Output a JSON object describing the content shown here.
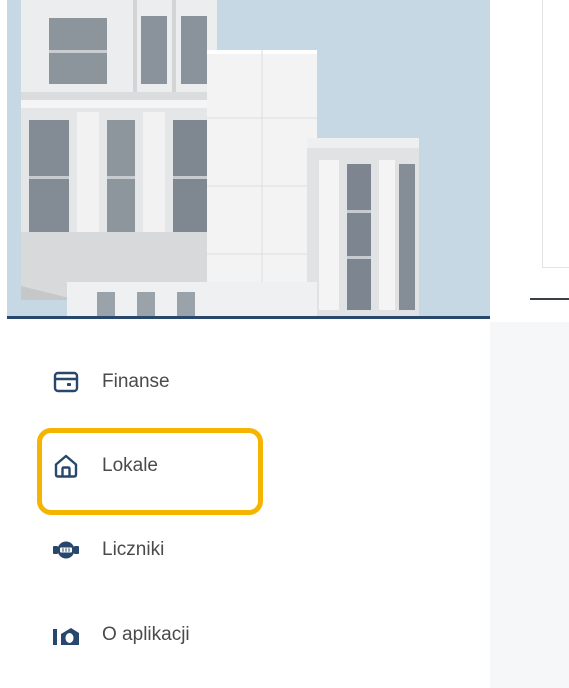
{
  "navigation": {
    "items": [
      {
        "label": "Finanse",
        "icon": "wallet-icon"
      },
      {
        "label": "Lokale",
        "icon": "home-icon"
      },
      {
        "label": "Liczniki",
        "icon": "meter-icon"
      },
      {
        "label": "O aplikacji",
        "icon": "app-logo-icon"
      }
    ],
    "highlighted_item": "Lokale"
  },
  "colors": {
    "accent": "#28476d",
    "highlight": "#f4b400",
    "text": "#4a4a4a"
  }
}
